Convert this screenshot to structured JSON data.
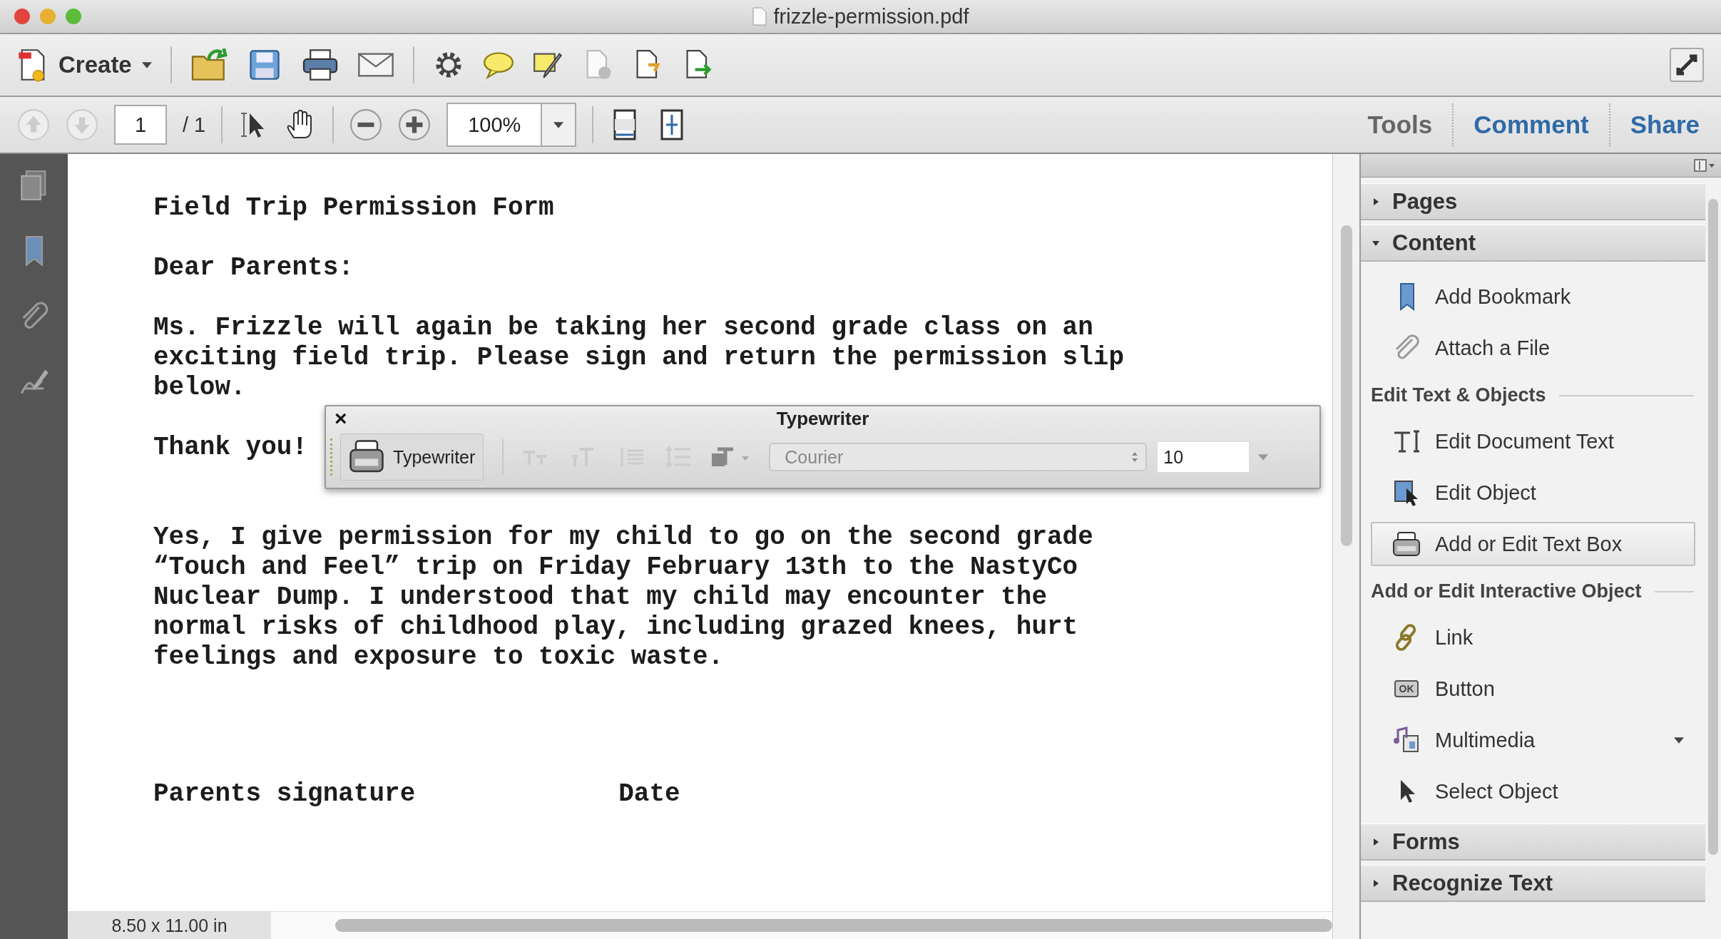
{
  "window": {
    "title": "frizzle-permission.pdf"
  },
  "toolbar": {
    "create_label": "Create"
  },
  "navigation": {
    "page_number": "1",
    "page_total": "/ 1",
    "zoom": "100%"
  },
  "tabs": [
    {
      "label": "Tools",
      "selected": true
    },
    {
      "label": "Comment",
      "selected": false
    },
    {
      "label": "Share",
      "selected": false
    }
  ],
  "document": {
    "paragraphs": [
      [
        "Field Trip Permission Form"
      ],
      [
        "Dear Parents:"
      ],
      [
        "Ms. Frizzle will again be taking her second grade class on an",
        "exciting field trip. Please sign and return the permission slip",
        "below."
      ],
      [
        "Thank you!"
      ],
      [
        "Yes, I give permission for my child to go on the second grade",
        "“Touch and Feel” trip on Friday February 13th to the NastyCo",
        "Nuclear Dump. I understood that my child may encounter the",
        "normal risks of childhood play, including grazed knees, hurt",
        "feelings and exposure to toxic waste."
      ]
    ],
    "signature_label": "Parents signature",
    "date_label": "Date"
  },
  "typewriter_bar": {
    "close": "×",
    "title": "Typewriter",
    "tool_label": "Typewriter",
    "tool_selected": true,
    "font": "Courier",
    "font_size": "10"
  },
  "status_bar": {
    "page_size": "8.50 x 11.00 in"
  },
  "panels": [
    {
      "title": "Pages",
      "expanded": false
    },
    {
      "title": "Content",
      "expanded": true,
      "groups": [
        {
          "items": [
            {
              "label": "Add Bookmark",
              "kind": "bookmark",
              "selected": false
            },
            {
              "label": "Attach a File",
              "kind": "paperclip",
              "selected": false
            }
          ]
        },
        {
          "title": "Edit Text & Objects",
          "items": [
            {
              "label": "Edit Document Text",
              "kind": "text",
              "selected": false
            },
            {
              "label": "Edit Object",
              "kind": "object",
              "selected": false
            },
            {
              "label": "Add or Edit Text Box",
              "kind": "typewriter",
              "selected": true
            }
          ]
        },
        {
          "title": "Add or Edit Interactive Object",
          "items": [
            {
              "label": "Link",
              "kind": "link",
              "selected": false
            },
            {
              "label": "Button",
              "kind": "button",
              "icon_text": "OK",
              "selected": false
            },
            {
              "label": "Multimedia",
              "kind": "multimedia",
              "selected": false,
              "submenu": true
            },
            {
              "label": "Select Object",
              "kind": "pointer",
              "selected": false
            }
          ]
        }
      ]
    },
    {
      "title": "Forms",
      "expanded": false
    },
    {
      "title": "Recognize Text",
      "expanded": false
    }
  ]
}
